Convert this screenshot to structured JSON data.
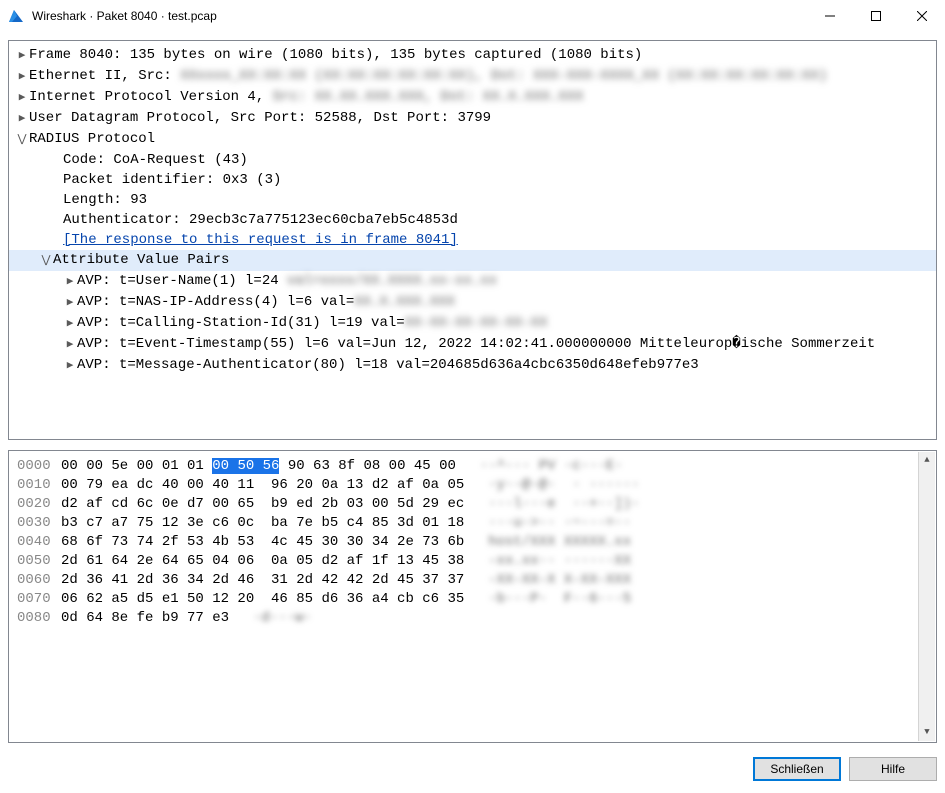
{
  "window": {
    "title": "Wireshark · Paket 8040 · test.pcap"
  },
  "buttons": {
    "close": "Schließen",
    "help": "Hilfe"
  },
  "tree": {
    "frame": "Frame 8040: 135 bytes on wire (1080 bits), 135 bytes captured (1080 bits)",
    "eth_pre": "Ethernet II, Src: ",
    "eth_blur": "XXxxxx_XX:XX:XX (XX:XX:XX:XX:XX:XX), Dst: XXX-XXX-XXXX_XX (XX:XX:XX:XX:XX:XX)",
    "ip_pre": "Internet Protocol Version 4, ",
    "ip_blur": "Src: XX.XX.XXX.XXX, Dst: XX.X.XXX.XXX",
    "udp": "User Datagram Protocol, Src Port: 52588, Dst Port: 3799",
    "radius": "RADIUS Protocol",
    "code": "Code: CoA-Request (43)",
    "pktid": "Packet identifier: 0x3 (3)",
    "length": "Length: 93",
    "auth": "Authenticator: 29ecb3c7a775123ec60cba7eb5c4853d",
    "resp_link": "[The response to this request is in frame 8041]",
    "avp_header": "Attribute Value Pairs",
    "avp1_pre": "AVP: t=User-Name(1) l=24 ",
    "avp1_blur": "val=xxxx/XX.XXXX.xx-xx.xx",
    "avp2_pre": "AVP: t=NAS-IP-Address(4) l=6 val=",
    "avp2_blur": "XX.X.XXX.XXX",
    "avp3_pre": "AVP: t=Calling-Station-Id(31) l=19 val=",
    "avp3_blur": "XX-XX-XX-XX-XX-XX",
    "avp4": "AVP: t=Event-Timestamp(55) l=6 val=Jun 12, 2022 14:02:41.000000000 Mitteleurop�ische Sommerzeit",
    "avp5": "AVP: t=Message-Authenticator(80) l=18 val=204685d636a4cbc6350d648efeb977e3"
  },
  "hex": {
    "lines": [
      {
        "off": "0000",
        "b1": "00 00 5e 00 01 01 ",
        "hl": "00 50 56",
        "b2": " 90 63 8f 08 00 45 00",
        "ascii": "··^··· PV ·c···E·"
      },
      {
        "off": "0010",
        "b1": "00 79 ea dc 40 00 40 11  96 20 0a 13 d2 af 0a 05",
        "hl": "",
        "b2": "",
        "ascii": "·y··@·@·  · ······"
      },
      {
        "off": "0020",
        "b1": "d2 af cd 6c 0e d7 00 65  b9 ed 2b 03 00 5d 29 ec",
        "hl": "",
        "b2": "",
        "ascii": "···l···e  ··+··])·"
      },
      {
        "off": "0030",
        "b1": "b3 c7 a7 75 12 3e c6 0c  ba 7e b5 c4 85 3d 01 18",
        "hl": "",
        "b2": "",
        "ascii": "···u·>·· ·~···=··"
      },
      {
        "off": "0040",
        "b1": "68 6f 73 74 2f 53 4b 53  4c 45 30 30 34 2e 73 6b",
        "hl": "",
        "b2": "",
        "ascii": "host/XXX XXXXX.xx"
      },
      {
        "off": "0050",
        "b1": "2d 61 64 2e 64 65 04 06  0a 05 d2 af 1f 13 45 38",
        "hl": "",
        "b2": "",
        "ascii": "-xx.xx·· ······XX"
      },
      {
        "off": "0060",
        "b1": "2d 36 41 2d 36 34 2d 46  31 2d 42 42 2d 45 37 37",
        "hl": "",
        "b2": "",
        "ascii": "-XX-XX-X X-XX-XXX"
      },
      {
        "off": "0070",
        "b1": "06 62 a5 d5 e1 50 12 20  46 85 d6 36 a4 cb c6 35",
        "hl": "",
        "b2": "",
        "ascii": "·b···P·  F··6···5"
      },
      {
        "off": "0080",
        "b1": "0d 64 8e fe b9 77 e3",
        "hl": "",
        "b2": "",
        "ascii": "·d···w·"
      }
    ]
  }
}
